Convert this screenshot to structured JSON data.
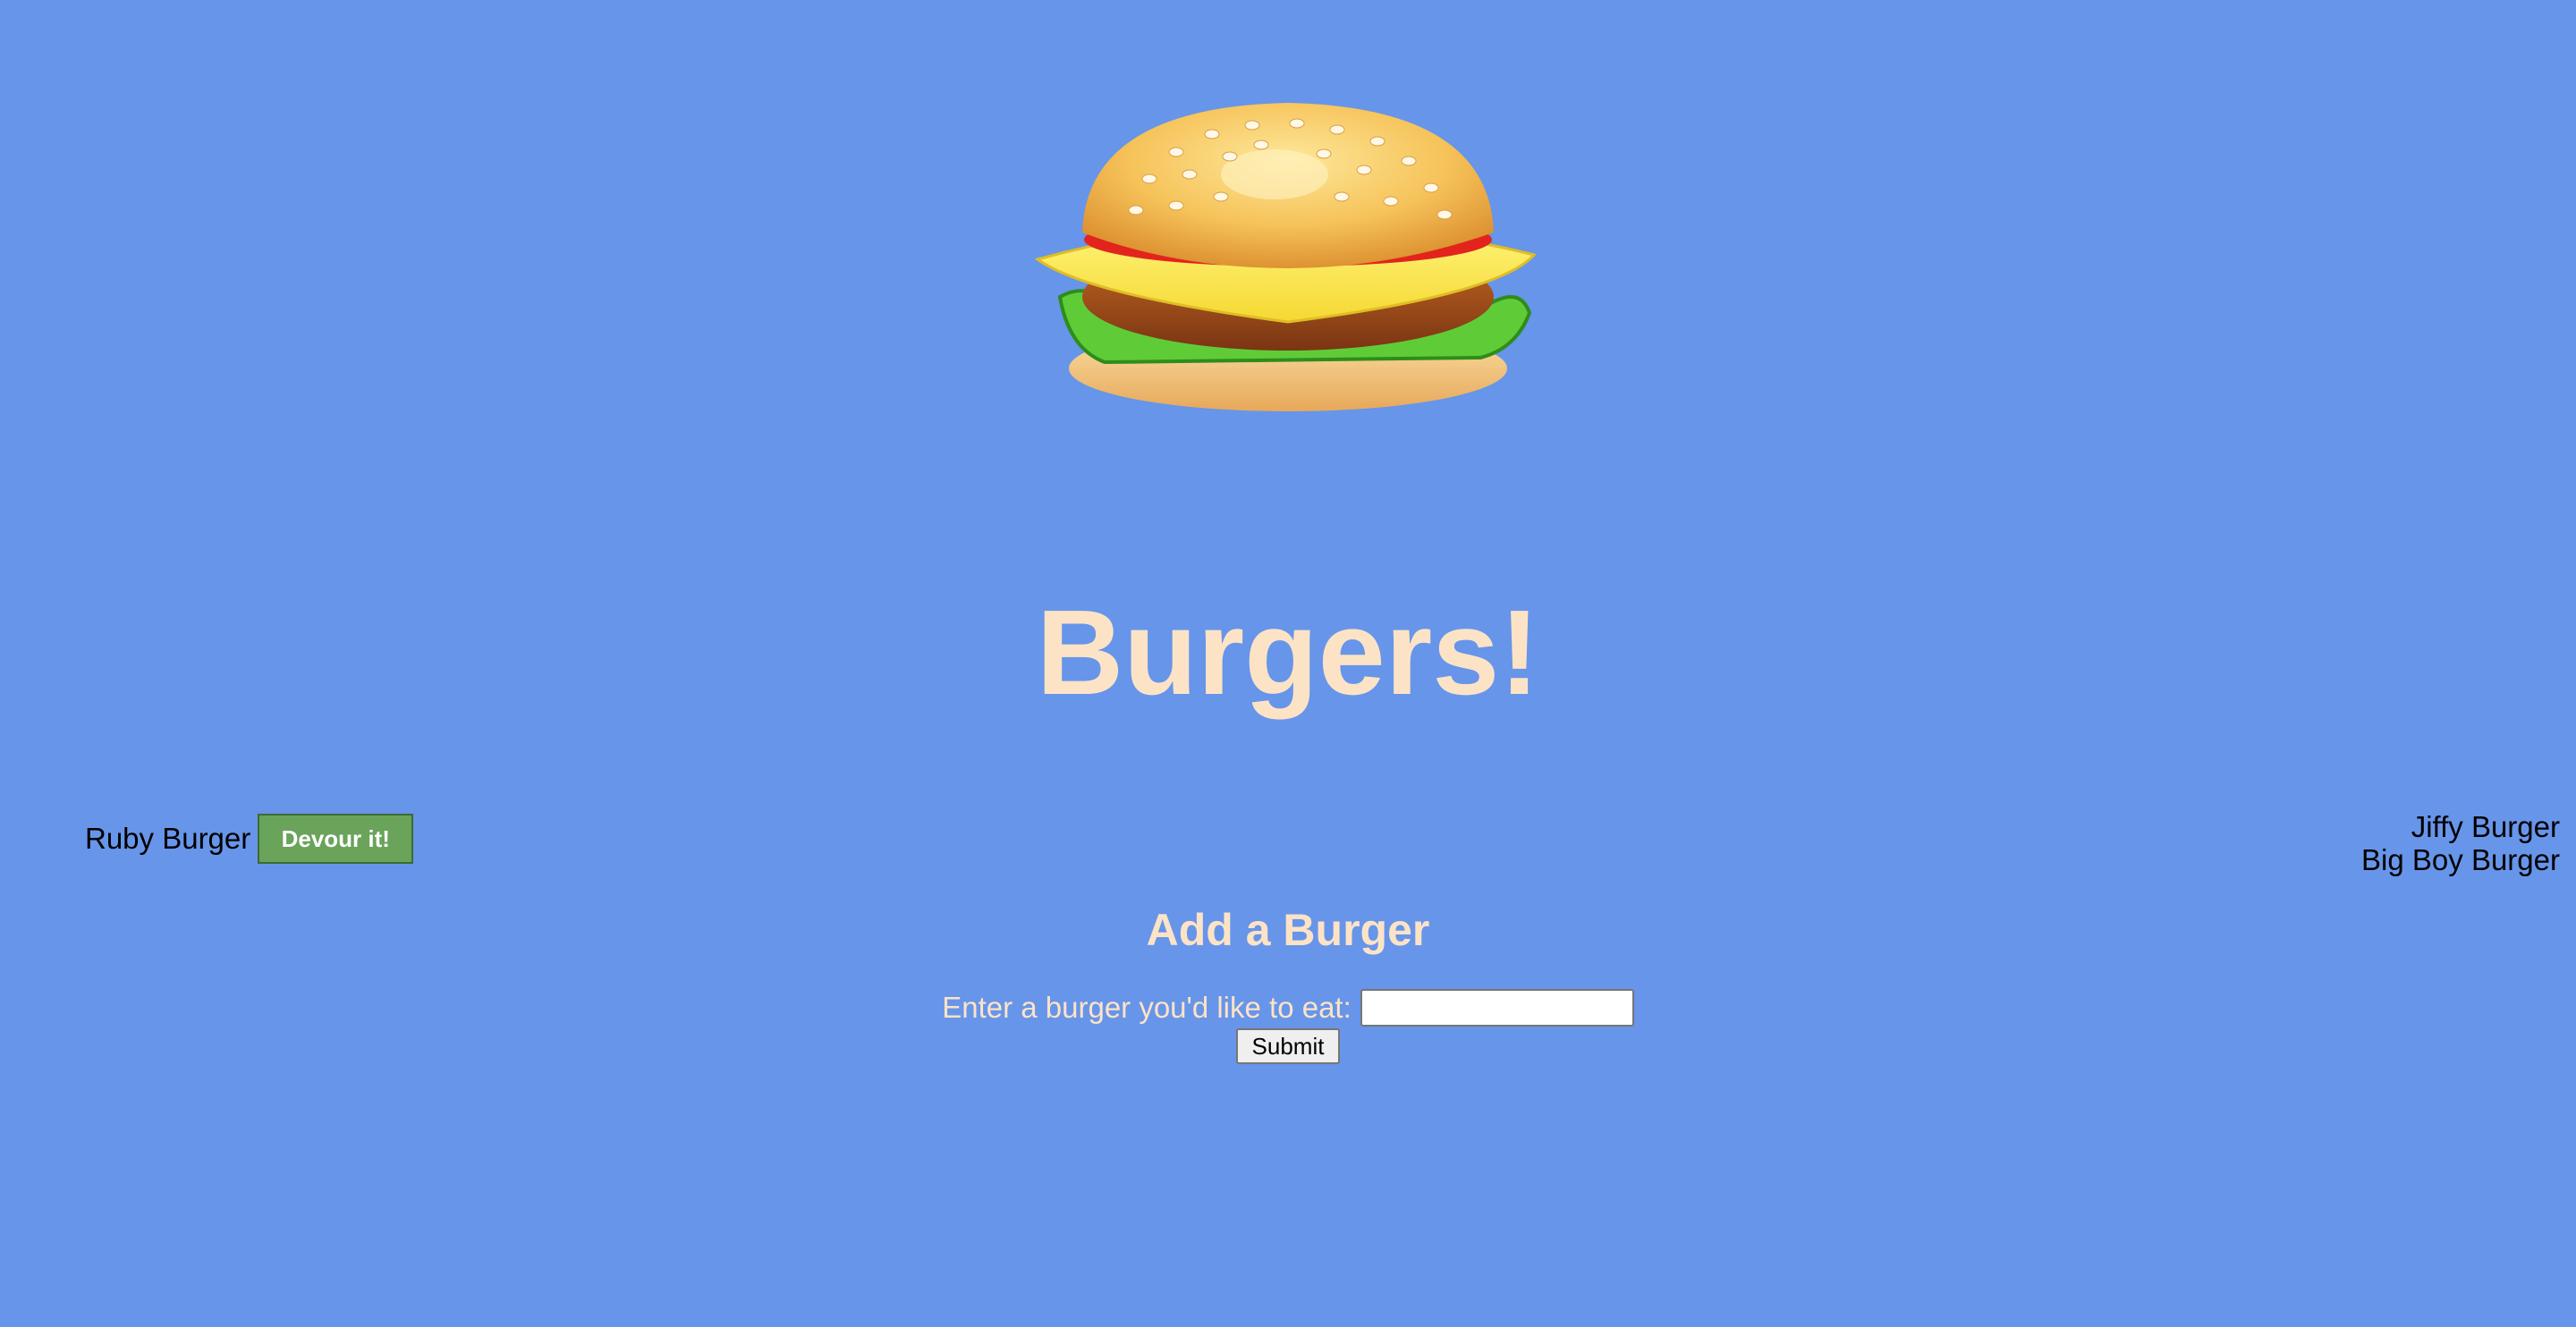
{
  "title": "Burgers!",
  "uneaten_burgers": [
    {
      "name": "Ruby Burger",
      "action_label": "Devour it!"
    }
  ],
  "devoured_burgers": [
    {
      "name": "Jiffy Burger"
    },
    {
      "name": "Big Boy Burger"
    }
  ],
  "add_form": {
    "heading": "Add a Burger",
    "label": "Enter a burger you'd like to eat:",
    "input_value": "",
    "submit_label": "Submit"
  },
  "colors": {
    "background": "#6795e9",
    "title": "#fde3c6",
    "devour_button": "#6aa35a"
  },
  "logo_icon": "burger-icon"
}
